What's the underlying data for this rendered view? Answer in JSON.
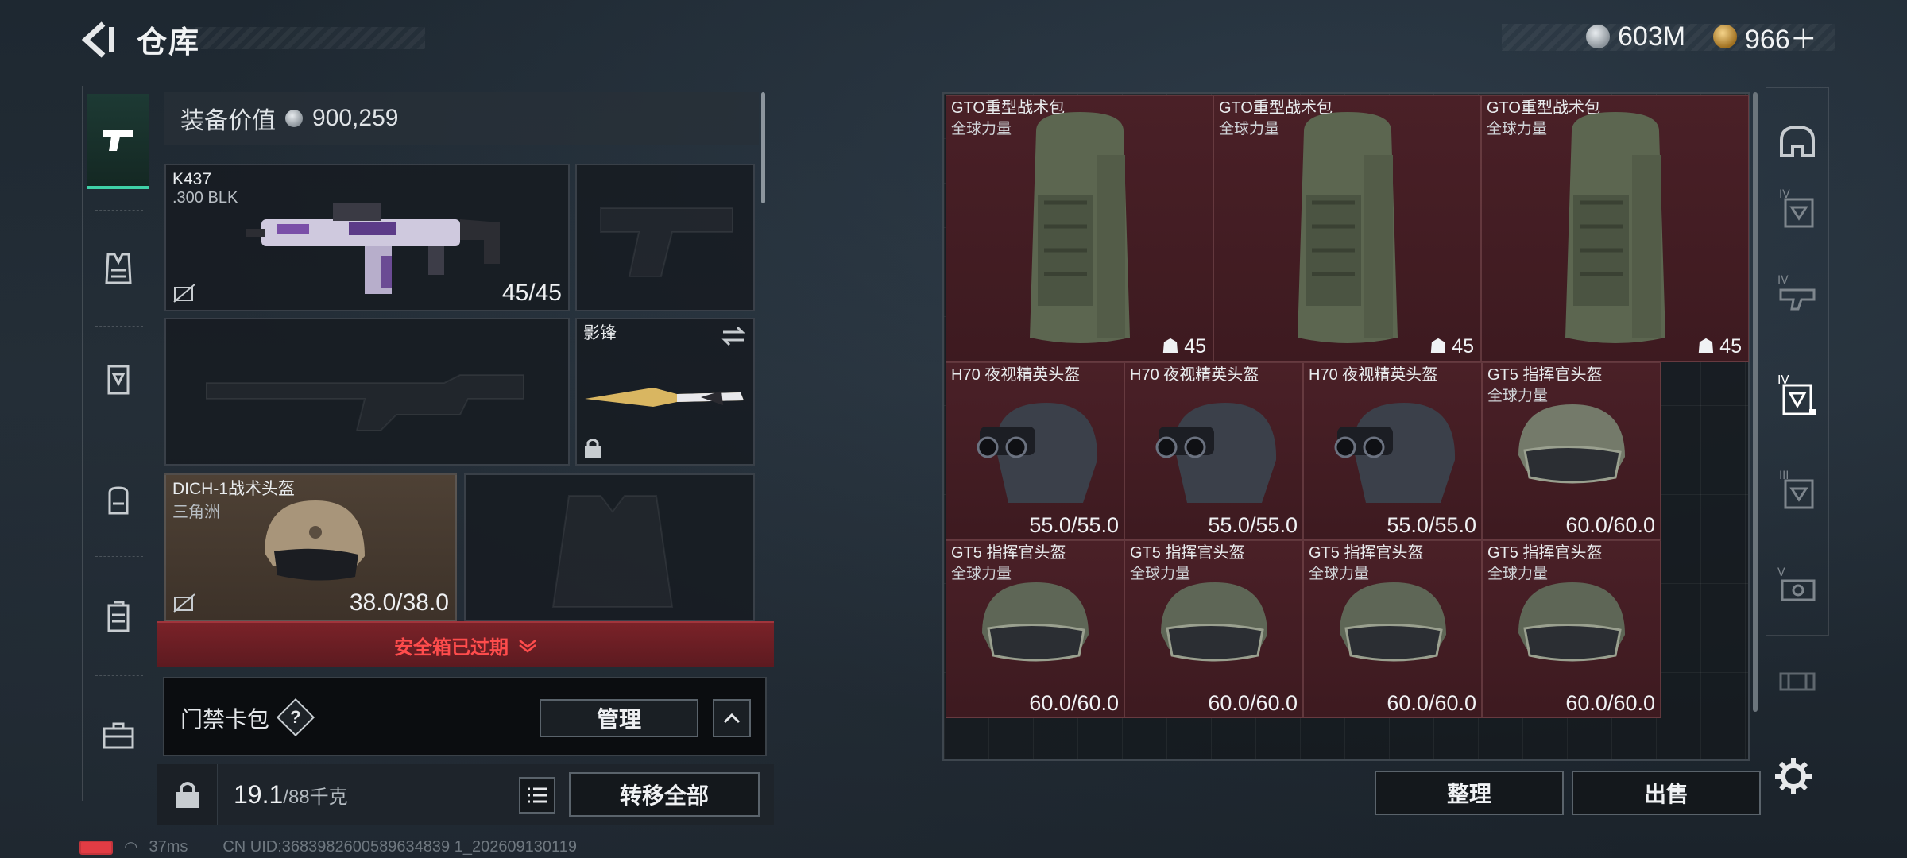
{
  "header": {
    "title": "仓库",
    "currencies": [
      {
        "icon": "silver-coin-icon",
        "value": "603M"
      },
      {
        "icon": "gold-coin-icon",
        "value": "966＋"
      }
    ]
  },
  "loadout": {
    "value_label": "装备价值",
    "value": "900,259",
    "primary": {
      "name": "K437",
      "sub": ".300 BLK",
      "ammo": "45/45"
    },
    "melee": {
      "name": "影锋"
    },
    "helmet": {
      "name": "DICH-1战术头盔",
      "sub": "三角洲",
      "durability": "38.0/38.0"
    },
    "expired_label": "安全箱已过期",
    "keycard": {
      "label": "门禁卡包",
      "help": "?",
      "manage": "管理"
    },
    "weight": {
      "current": "19.1",
      "max": "/88千克"
    },
    "transfer_all": "转移全部"
  },
  "status": {
    "ping": "37ms",
    "uid": "CN UID:3683982600589634839 1_202609130119"
  },
  "stash": {
    "row1": [
      {
        "name": "GTO重型战术包",
        "sub": "全球力量",
        "capacity": "45"
      },
      {
        "name": "GTO重型战术包",
        "sub": "全球力量",
        "capacity": "45"
      },
      {
        "name": "GTO重型战术包",
        "sub": "全球力量",
        "capacity": "45"
      }
    ],
    "row2": [
      {
        "name": "H70 夜视精英头盔",
        "sub": "",
        "durability": "55.0/55.0"
      },
      {
        "name": "H70 夜视精英头盔",
        "sub": "",
        "durability": "55.0/55.0"
      },
      {
        "name": "H70 夜视精英头盔",
        "sub": "",
        "durability": "55.0/55.0"
      },
      {
        "name": "GT5 指挥官头盔",
        "sub": "全球力量",
        "durability": "60.0/60.0"
      }
    ],
    "row3": [
      {
        "name": "GT5 指挥官头盔",
        "sub": "全球力量",
        "durability": "60.0/60.0"
      },
      {
        "name": "GT5 指挥官头盔",
        "sub": "全球力量",
        "durability": "60.0/60.0"
      },
      {
        "name": "GT5 指挥官头盔",
        "sub": "全球力量",
        "durability": "60.0/60.0"
      },
      {
        "name": "GT5 指挥官头盔",
        "sub": "全球力量",
        "durability": "60.0/60.0"
      }
    ],
    "sort": "整理",
    "sell": "出售"
  },
  "filters": [
    {
      "icon": "helmet-filter-icon"
    },
    {
      "icon": "armor-iv-filter-icon",
      "tag": "IV"
    },
    {
      "icon": "rig-iv-filter-icon",
      "tag": "IV"
    },
    {
      "icon": "armor-iv-filter-icon",
      "tag": "IV"
    },
    {
      "icon": "armor-iii-filter-icon",
      "tag": "III"
    },
    {
      "icon": "armor-v-filter-icon",
      "tag": "V"
    },
    {
      "icon": "rig-filter-icon"
    }
  ],
  "colors": {
    "accent": "#3fd1a8",
    "danger": "#ff4c4c",
    "cell_bg": "#4a2027"
  }
}
